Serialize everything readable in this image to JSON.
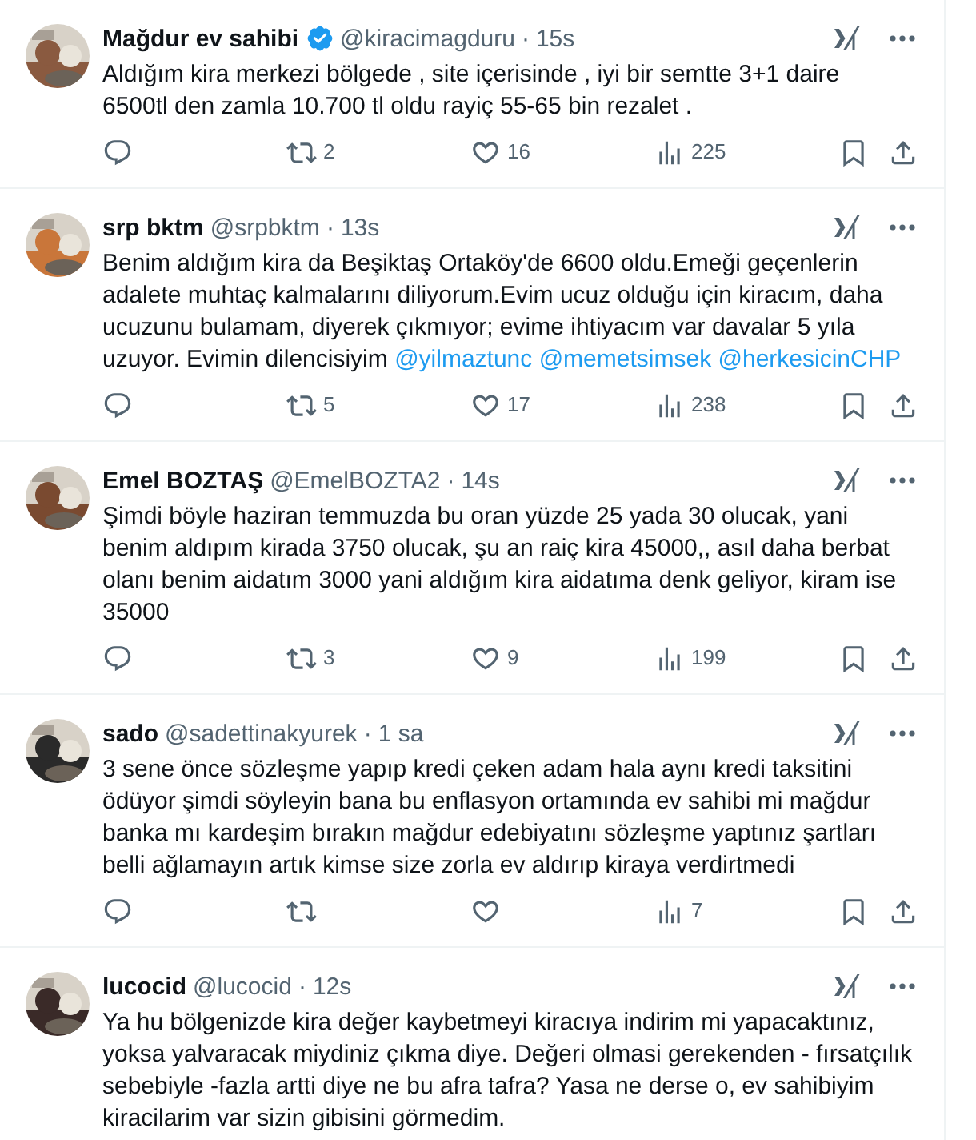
{
  "tweets": [
    {
      "name": "Mağdur ev sahibi",
      "verified": true,
      "handle": "@kiracimagduru",
      "separator": "·",
      "time": "15s",
      "lines": [
        "Aldığım kira merkezi bölgede , site içerisinde , iyi bir semtte 3+1 daire",
        "6500tl den zamla 10.700 tl oldu rayiç 55-65 bin rezalet ."
      ],
      "actions": {
        "retweets": "2",
        "likes": "16",
        "views": "225"
      }
    },
    {
      "name": "srp bktm",
      "verified": false,
      "handle": "@srpbktm",
      "separator": "·",
      "time": "13s",
      "lines": [
        "Benim aldığım kira da Beşiktaş Ortaköy'de 6600 oldu.Emeği geçenlerin",
        "adalete muhtaç kalmalarını diliyorum.Evim ucuz olduğu için kiracım, daha",
        "ucuzunu bulamam, diyerek çıkmıyor; evime ihtiyacım var davalar 5 yıla",
        "uzuyor. Evimin dilencisiyim"
      ],
      "mentions": [
        "@yilmaztunc",
        "@memetsimsek",
        "@herkesicinCHP"
      ],
      "actions": {
        "retweets": "5",
        "likes": "17",
        "views": "238"
      }
    },
    {
      "name": "Emel BOZTAŞ",
      "verified": false,
      "handle": "@EmelBOZTA2",
      "separator": "·",
      "time": "14s",
      "lines": [
        "Şimdi böyle haziran temmuzda bu oran yüzde 25 yada 30 olucak, yani",
        "benim aldıpım kirada 3750 olucak, şu an raiç kira 45000,, asıl daha berbat",
        "olanı benim aidatım 3000 yani aldığım kira aidatıma denk geliyor, kiram ise",
        "35000"
      ],
      "actions": {
        "retweets": "3",
        "likes": "9",
        "views": "199"
      }
    },
    {
      "name": "sado",
      "verified": false,
      "handle": "@sadettinakyurek",
      "separator": "·",
      "time": "1 sa",
      "lines": [
        "3 sene önce sözleşme yapıp kredi çeken adam hala aynı kredi taksitini",
        "ödüyor şimdi söyleyin bana bu enflasyon ortamında ev sahibi mi mağdur",
        "banka mı kardeşim bırakın mağdur edebiyatını sözleşme yaptınız şartları",
        "belli ağlamayın artık kimse size zorla ev aldırıp kiraya verdirtmedi"
      ],
      "actions": {
        "views": "7"
      }
    },
    {
      "name": "lucocid",
      "verified": false,
      "handle": "@lucocid",
      "separator": "·",
      "time": "12s",
      "lines": [
        "Ya hu bölgenizde kira değer kaybetmeyi kiracıya indirim mi yapacaktınız,",
        "yoksa yalvaracak miydiniz çıkma diye. Değeri olmasi gerekenden - fırsatçılık",
        "sebebiyle -fazla artti diye ne bu afra tafra? Yasa ne derse o, ev sahibiyim",
        "kiracilarim var sizin gibisini görmedim."
      ]
    }
  ]
}
